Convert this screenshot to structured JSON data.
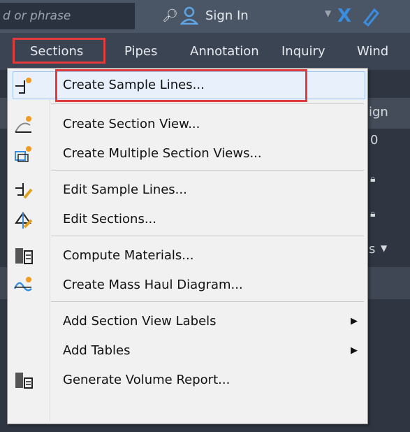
{
  "topbar": {
    "search_placeholder": "d or phrase",
    "signin_label": "Sign In"
  },
  "ribbon": {
    "tabs": [
      "Sections",
      "Pipes",
      "Annotation",
      "Inquiry",
      "Wind"
    ]
  },
  "workspace": {
    "fragments": [
      "ign",
      "0",
      "s"
    ]
  },
  "menu": {
    "items": [
      {
        "label": "Create Sample Lines...",
        "icon": "create-sample-lines-icon",
        "selected": true
      },
      {
        "label": "Create Section View...",
        "icon": "create-section-view-icon"
      },
      {
        "label": "Create Multiple Section Views...",
        "icon": "create-multiple-section-views-icon"
      },
      {
        "label": "Edit Sample Lines...",
        "icon": "edit-sample-lines-icon"
      },
      {
        "label": "Edit Sections...",
        "icon": "edit-sections-icon"
      },
      {
        "label": "Compute Materials...",
        "icon": "compute-materials-icon"
      },
      {
        "label": "Create Mass Haul Diagram...",
        "icon": "create-mass-haul-diagram-icon"
      },
      {
        "label": "Add Section View Labels",
        "submenu": true
      },
      {
        "label": "Add Tables",
        "submenu": true
      },
      {
        "label": "Generate Volume Report...",
        "icon": "generate-volume-report-icon"
      }
    ]
  },
  "colors": {
    "highlight_red": "#e23b3b",
    "ribbon": "#3b4453",
    "topbar": "#4a5565",
    "menu_bg": "#f1f1f1",
    "accent_blue": "#3a8ee0"
  }
}
